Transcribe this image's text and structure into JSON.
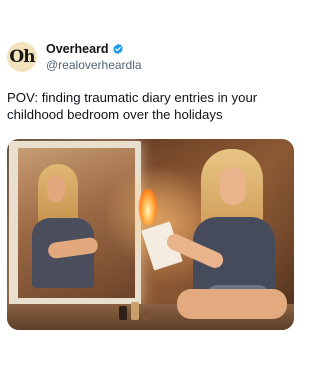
{
  "account": {
    "avatar_text": "Oh",
    "display_name": "Overheard",
    "handle": "@realoverheardla",
    "verified": true
  },
  "post": {
    "text": "POV: finding traumatic diary entries in your\nchildhood bedroom over the holidays"
  },
  "media": {
    "alt": "Woman sitting by a bathroom mirror burning a diary page"
  },
  "colors": {
    "verified_badge": "#1d9bf0",
    "avatar_bg": "#f3e3bd",
    "text_primary": "#0f1419",
    "text_secondary": "#536471"
  }
}
